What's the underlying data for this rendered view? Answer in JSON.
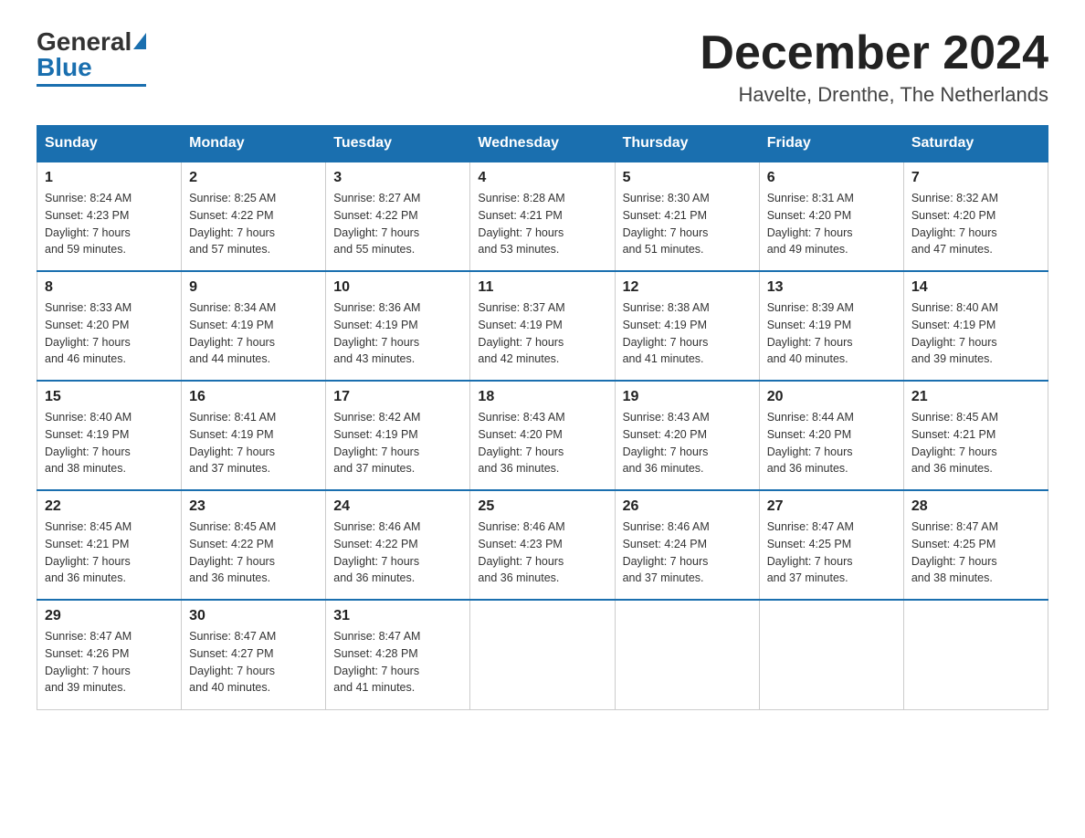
{
  "logo": {
    "general": "General",
    "blue": "Blue"
  },
  "title": "December 2024",
  "location": "Havelte, Drenthe, The Netherlands",
  "days_of_week": [
    "Sunday",
    "Monday",
    "Tuesday",
    "Wednesday",
    "Thursday",
    "Friday",
    "Saturday"
  ],
  "weeks": [
    [
      {
        "day": "1",
        "sunrise": "8:24 AM",
        "sunset": "4:23 PM",
        "daylight": "7 hours and 59 minutes."
      },
      {
        "day": "2",
        "sunrise": "8:25 AM",
        "sunset": "4:22 PM",
        "daylight": "7 hours and 57 minutes."
      },
      {
        "day": "3",
        "sunrise": "8:27 AM",
        "sunset": "4:22 PM",
        "daylight": "7 hours and 55 minutes."
      },
      {
        "day": "4",
        "sunrise": "8:28 AM",
        "sunset": "4:21 PM",
        "daylight": "7 hours and 53 minutes."
      },
      {
        "day": "5",
        "sunrise": "8:30 AM",
        "sunset": "4:21 PM",
        "daylight": "7 hours and 51 minutes."
      },
      {
        "day": "6",
        "sunrise": "8:31 AM",
        "sunset": "4:20 PM",
        "daylight": "7 hours and 49 minutes."
      },
      {
        "day": "7",
        "sunrise": "8:32 AM",
        "sunset": "4:20 PM",
        "daylight": "7 hours and 47 minutes."
      }
    ],
    [
      {
        "day": "8",
        "sunrise": "8:33 AM",
        "sunset": "4:20 PM",
        "daylight": "7 hours and 46 minutes."
      },
      {
        "day": "9",
        "sunrise": "8:34 AM",
        "sunset": "4:19 PM",
        "daylight": "7 hours and 44 minutes."
      },
      {
        "day": "10",
        "sunrise": "8:36 AM",
        "sunset": "4:19 PM",
        "daylight": "7 hours and 43 minutes."
      },
      {
        "day": "11",
        "sunrise": "8:37 AM",
        "sunset": "4:19 PM",
        "daylight": "7 hours and 42 minutes."
      },
      {
        "day": "12",
        "sunrise": "8:38 AM",
        "sunset": "4:19 PM",
        "daylight": "7 hours and 41 minutes."
      },
      {
        "day": "13",
        "sunrise": "8:39 AM",
        "sunset": "4:19 PM",
        "daylight": "7 hours and 40 minutes."
      },
      {
        "day": "14",
        "sunrise": "8:40 AM",
        "sunset": "4:19 PM",
        "daylight": "7 hours and 39 minutes."
      }
    ],
    [
      {
        "day": "15",
        "sunrise": "8:40 AM",
        "sunset": "4:19 PM",
        "daylight": "7 hours and 38 minutes."
      },
      {
        "day": "16",
        "sunrise": "8:41 AM",
        "sunset": "4:19 PM",
        "daylight": "7 hours and 37 minutes."
      },
      {
        "day": "17",
        "sunrise": "8:42 AM",
        "sunset": "4:19 PM",
        "daylight": "7 hours and 37 minutes."
      },
      {
        "day": "18",
        "sunrise": "8:43 AM",
        "sunset": "4:20 PM",
        "daylight": "7 hours and 36 minutes."
      },
      {
        "day": "19",
        "sunrise": "8:43 AM",
        "sunset": "4:20 PM",
        "daylight": "7 hours and 36 minutes."
      },
      {
        "day": "20",
        "sunrise": "8:44 AM",
        "sunset": "4:20 PM",
        "daylight": "7 hours and 36 minutes."
      },
      {
        "day": "21",
        "sunrise": "8:45 AM",
        "sunset": "4:21 PM",
        "daylight": "7 hours and 36 minutes."
      }
    ],
    [
      {
        "day": "22",
        "sunrise": "8:45 AM",
        "sunset": "4:21 PM",
        "daylight": "7 hours and 36 minutes."
      },
      {
        "day": "23",
        "sunrise": "8:45 AM",
        "sunset": "4:22 PM",
        "daylight": "7 hours and 36 minutes."
      },
      {
        "day": "24",
        "sunrise": "8:46 AM",
        "sunset": "4:22 PM",
        "daylight": "7 hours and 36 minutes."
      },
      {
        "day": "25",
        "sunrise": "8:46 AM",
        "sunset": "4:23 PM",
        "daylight": "7 hours and 36 minutes."
      },
      {
        "day": "26",
        "sunrise": "8:46 AM",
        "sunset": "4:24 PM",
        "daylight": "7 hours and 37 minutes."
      },
      {
        "day": "27",
        "sunrise": "8:47 AM",
        "sunset": "4:25 PM",
        "daylight": "7 hours and 37 minutes."
      },
      {
        "day": "28",
        "sunrise": "8:47 AM",
        "sunset": "4:25 PM",
        "daylight": "7 hours and 38 minutes."
      }
    ],
    [
      {
        "day": "29",
        "sunrise": "8:47 AM",
        "sunset": "4:26 PM",
        "daylight": "7 hours and 39 minutes."
      },
      {
        "day": "30",
        "sunrise": "8:47 AM",
        "sunset": "4:27 PM",
        "daylight": "7 hours and 40 minutes."
      },
      {
        "day": "31",
        "sunrise": "8:47 AM",
        "sunset": "4:28 PM",
        "daylight": "7 hours and 41 minutes."
      },
      null,
      null,
      null,
      null
    ]
  ],
  "labels": {
    "sunrise": "Sunrise:",
    "sunset": "Sunset:",
    "daylight": "Daylight:"
  }
}
